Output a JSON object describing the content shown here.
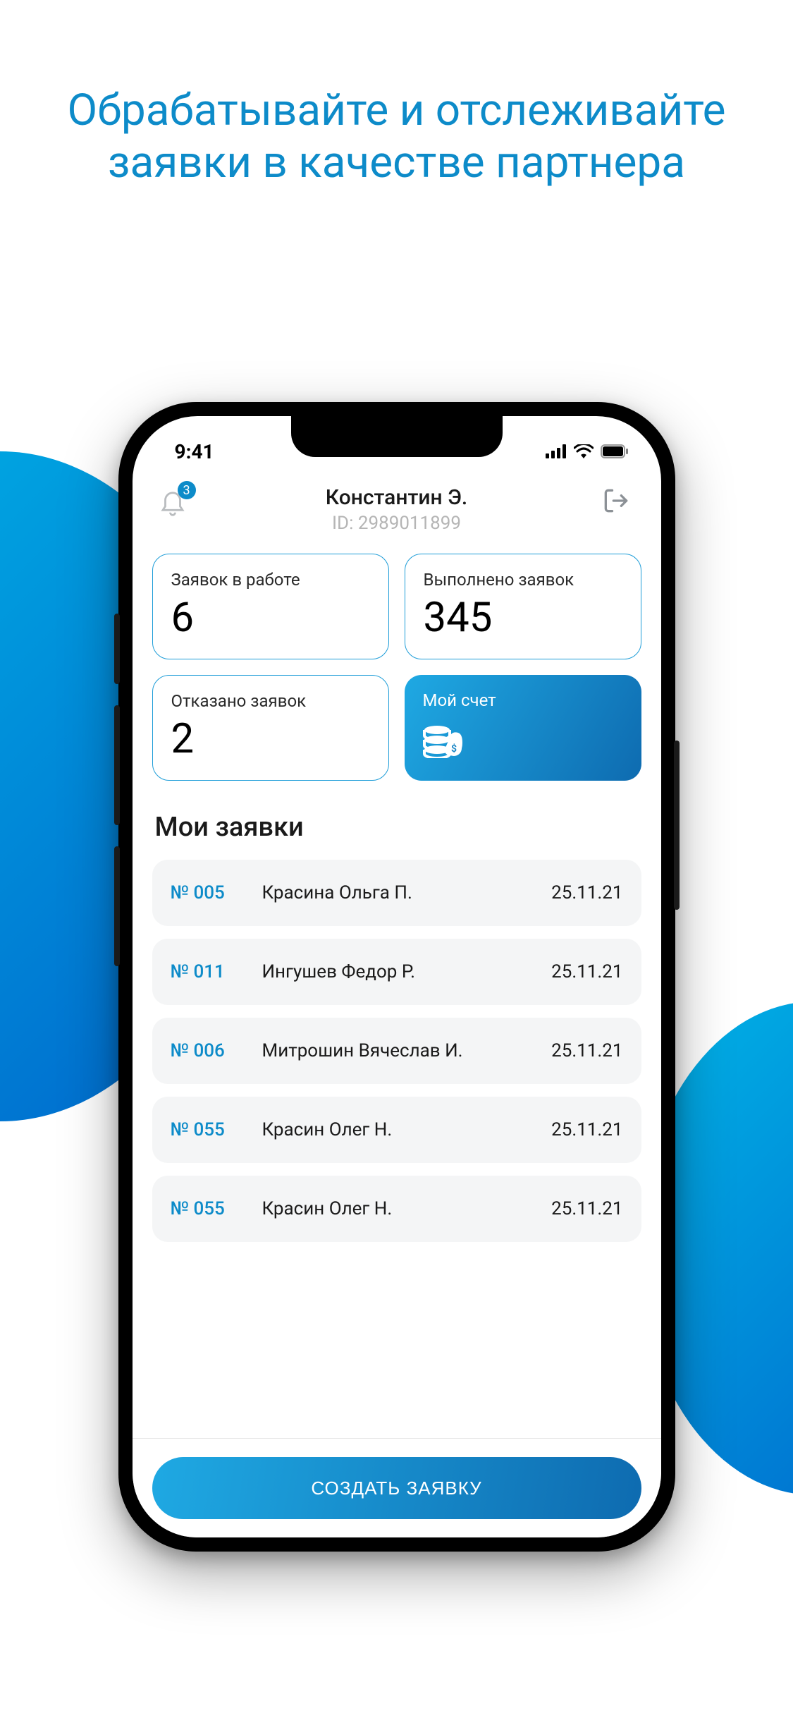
{
  "promo": {
    "heading": "Обрабатывайте и отслеживайте заявки в качестве партнера"
  },
  "status": {
    "time": "9:41"
  },
  "header": {
    "notif_badge": "3",
    "user_name": "Константин Э.",
    "user_id": "ID: 2989011899"
  },
  "stats": {
    "in_work_label": "Заявок в работе",
    "in_work_value": "6",
    "done_label": "Выполнено заявок",
    "done_value": "345",
    "rejected_label": "Отказано заявок",
    "rejected_value": "2",
    "account_label": "Мой счет"
  },
  "section": {
    "requests_title": "Мои заявки"
  },
  "requests": [
    {
      "num": "№ 005",
      "name": "Красина Ольга П.",
      "date": "25.11.21"
    },
    {
      "num": "№ 011",
      "name": "Ингушев Федор Р.",
      "date": "25.11.21"
    },
    {
      "num": "№ 006",
      "name": "Митрошин Вячеслав И.",
      "date": "25.11.21"
    },
    {
      "num": "№ 055",
      "name": "Красин Олег Н.",
      "date": "25.11.21"
    },
    {
      "num": "№ 055",
      "name": "Красин Олег Н.",
      "date": "25.11.21"
    }
  ],
  "cta": {
    "label": "СОЗДАТЬ ЗАЯВКУ"
  }
}
